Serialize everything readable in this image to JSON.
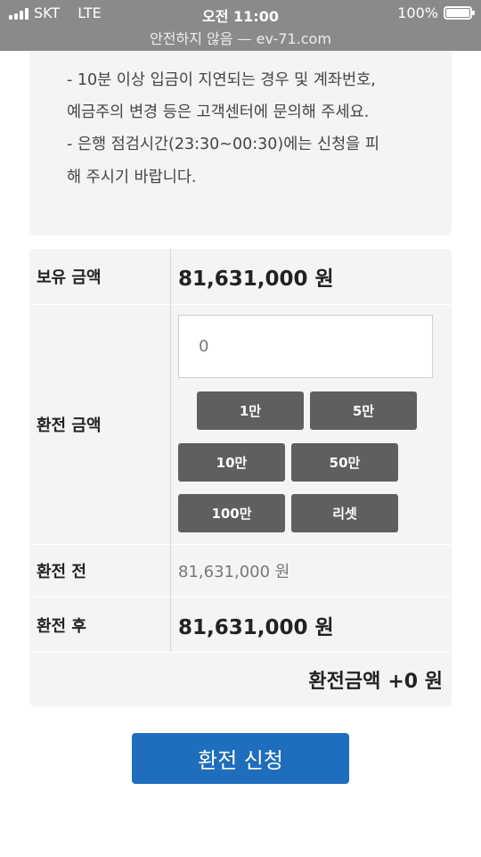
{
  "status_bar": {
    "carrier": "SKT",
    "network": "LTE",
    "time": "오전 11:00",
    "battery": "100%",
    "url_text": "안전하지 않음 — ev-71.com"
  },
  "notice": {
    "lines": [
      "- 10분 이상 입금이 지연되는 경우 및 계좌번호,",
      "예금주의 변경 등은 고객센터에 문의해 주세요.",
      "- 은행 점검시간(23:30~00:30)에는 신청을 피",
      "해 주시기 바랍니다."
    ]
  },
  "form": {
    "balance_label": "보유 금액",
    "balance_value": "81,631,000 원",
    "exchange_label": "환전 금액",
    "amount_input_value": "0",
    "quick_buttons": [
      "1만",
      "5만",
      "10만",
      "50만",
      "100만",
      "리셋"
    ],
    "before_label": "환전 전",
    "before_value": "81,631,000 원",
    "after_label": "환전 후",
    "after_value": "81,631,000 원"
  },
  "total": {
    "label": "환전금액",
    "value": "+0 원"
  },
  "submit_label": "환전 신청"
}
